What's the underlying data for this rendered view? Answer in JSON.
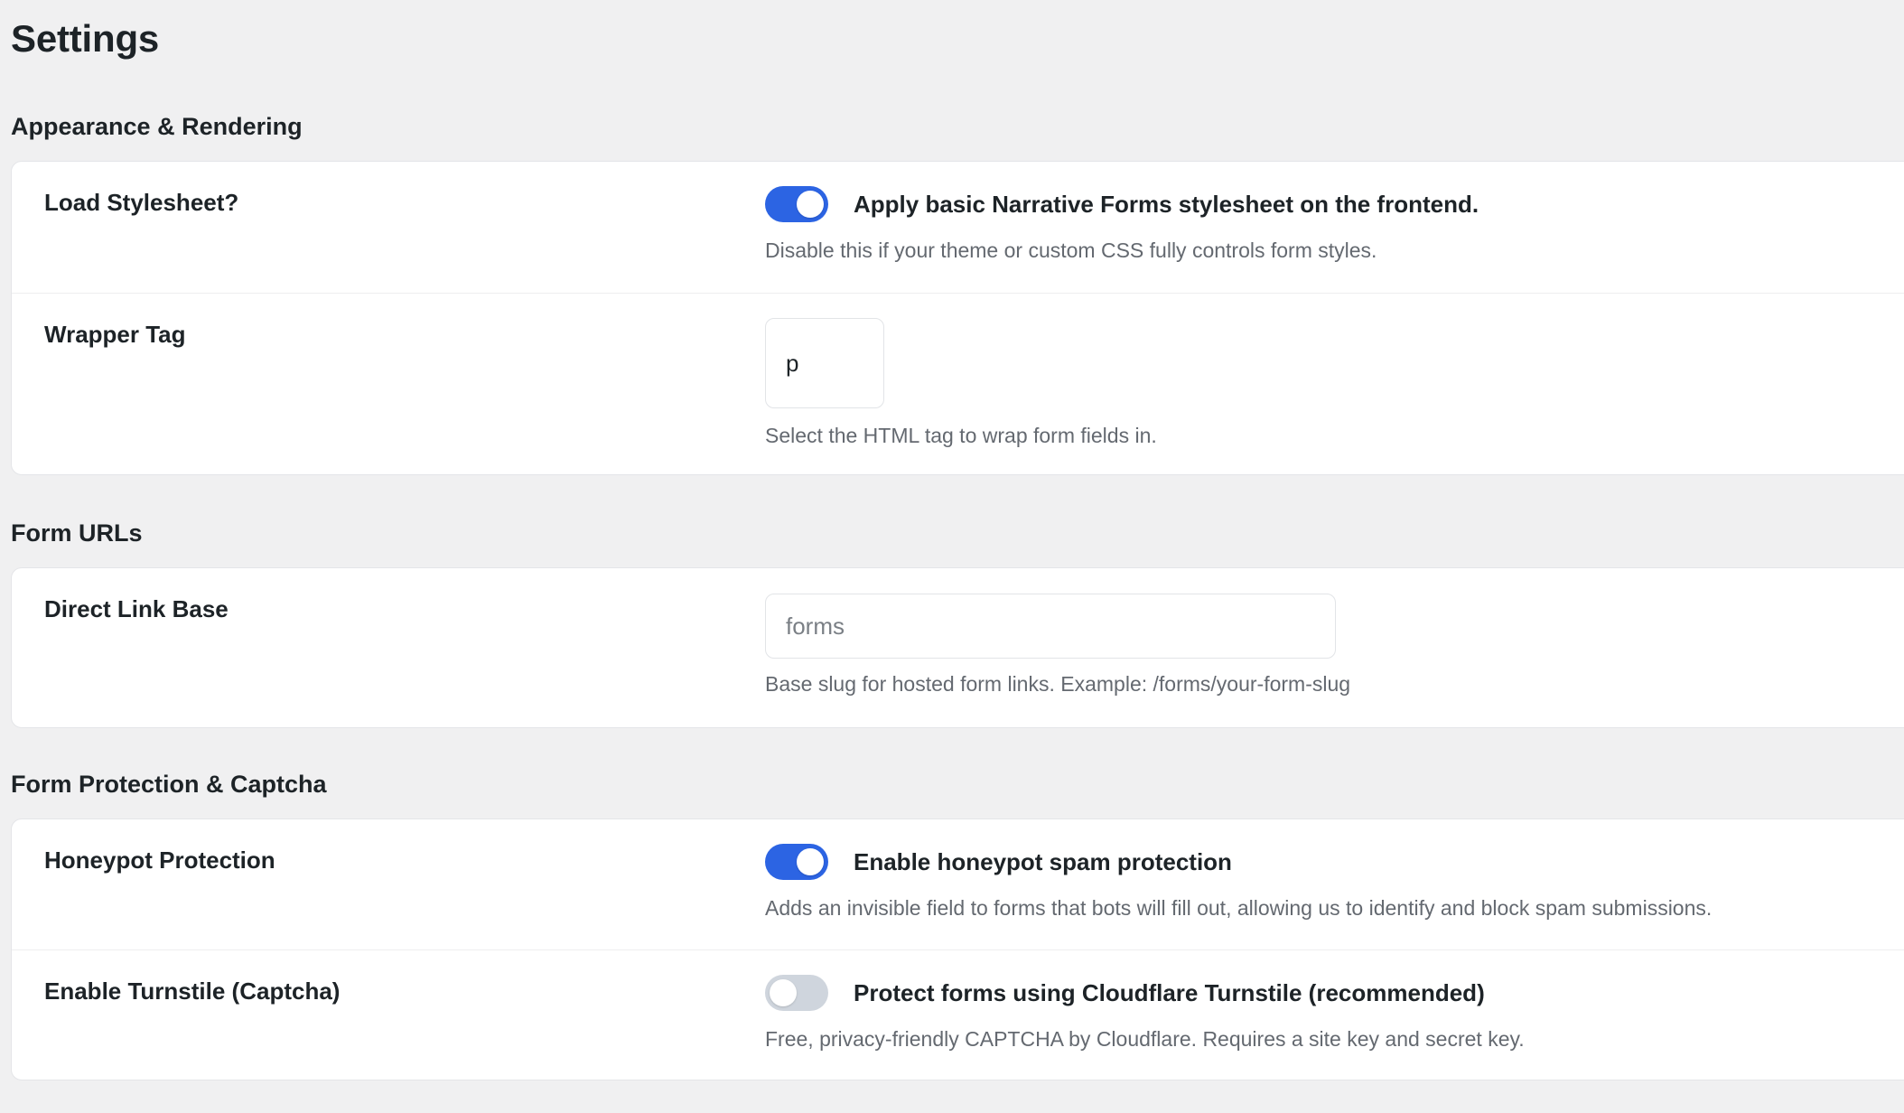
{
  "page": {
    "title": "Settings"
  },
  "colors": {
    "background": "#f0f0f1",
    "toggle_on": "#2c64e3",
    "toggle_off": "#cfd5dd",
    "description": "#646970"
  },
  "sections": [
    {
      "heading": "Appearance & Rendering",
      "rows": [
        {
          "label": "Load Stylesheet?",
          "toggle_on": true,
          "toggle_text": "Apply basic Narrative Forms stylesheet on the frontend.",
          "description": "Disable this if your theme or custom CSS fully controls form styles."
        },
        {
          "label": "Wrapper Tag",
          "input_value": "p",
          "description": "Select the HTML tag to wrap form fields in."
        }
      ]
    },
    {
      "heading": "Form URLs",
      "rows": [
        {
          "label": "Direct Link Base",
          "input_placeholder": "forms",
          "description": "Base slug for hosted form links. Example: /forms/your-form-slug"
        }
      ]
    },
    {
      "heading": "Form Protection & Captcha",
      "rows": [
        {
          "label": "Honeypot Protection",
          "toggle_on": true,
          "toggle_text": "Enable honeypot spam protection",
          "description": "Adds an invisible field to forms that bots will fill out, allowing us to identify and block spam submissions."
        },
        {
          "label": "Enable Turnstile (Captcha)",
          "toggle_on": false,
          "toggle_text": "Protect forms using Cloudflare Turnstile (recommended)",
          "description": "Free, privacy-friendly CAPTCHA by Cloudflare. Requires a site key and secret key."
        }
      ]
    }
  ]
}
